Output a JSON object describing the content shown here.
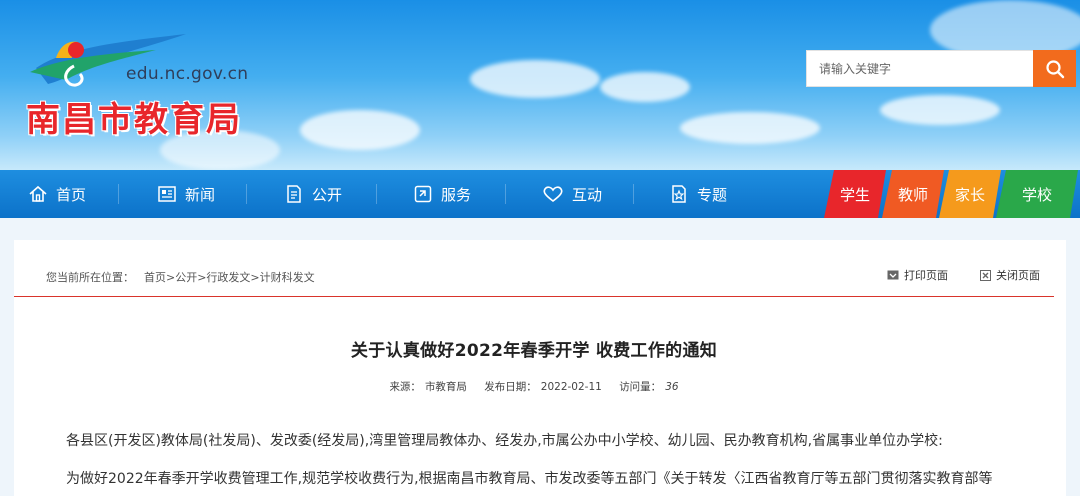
{
  "header": {
    "site_url": "edu.nc.gov.cn",
    "site_name": "南昌市教育局",
    "search_placeholder": "请输入关键字",
    "search_icon": "search-icon"
  },
  "nav": {
    "items": [
      {
        "label": "首页",
        "icon": "home-icon"
      },
      {
        "label": "新闻",
        "icon": "newspaper-icon"
      },
      {
        "label": "公开",
        "icon": "document-icon"
      },
      {
        "label": "服务",
        "icon": "service-icon"
      },
      {
        "label": "互动",
        "icon": "heart-icon"
      },
      {
        "label": "专题",
        "icon": "star-page-icon"
      }
    ],
    "roles": [
      {
        "label": "学生",
        "color": "#e8262b"
      },
      {
        "label": "教师",
        "color": "#f05a23"
      },
      {
        "label": "家长",
        "color": "#f59a1c"
      },
      {
        "label": "学校",
        "color": "#2aa84a"
      }
    ]
  },
  "breadcrumb": {
    "prefix": "您当前所在位置：",
    "path": "首页>公开>行政发文>计财科发文"
  },
  "tools": {
    "print": "打印页面",
    "close": "关闭页面"
  },
  "article": {
    "title": "关于认真做好2022年春季开学 收费工作的通知",
    "source_label": "来源：",
    "source": "市教育局",
    "date_label": "发布日期：",
    "date": "2022-02-11",
    "views_label": "访问量：",
    "views": "36",
    "paragraphs": [
      "各县区(开发区)教体局(社发局)、发改委(经发局),湾里管理局教体办、经发办,市属公办中小学校、幼儿园、民办教育机构,省属事业单位办学校:",
      "为做好2022年春季开学收费管理工作,规范学校收费行为,根据南昌市教育局、市发改委等五部门《关于转发〈江西省教育厅等五部门贯彻落实教育部等"
    ]
  }
}
